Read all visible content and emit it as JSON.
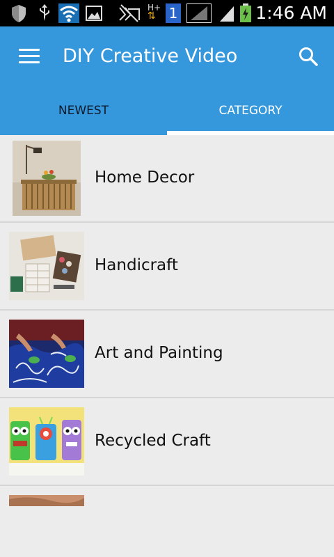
{
  "status_bar": {
    "time": "1:46 AM",
    "signal_badge": "1",
    "network_label": "H+"
  },
  "app_bar": {
    "title": "DIY Creative Video"
  },
  "tabs": [
    {
      "label": "NEWEST",
      "selected": false
    },
    {
      "label": "CATEGORY",
      "selected": true
    }
  ],
  "categories": [
    {
      "label": "Home Decor"
    },
    {
      "label": "Handicraft"
    },
    {
      "label": "Art and Painting"
    },
    {
      "label": "Recycled Craft"
    }
  ],
  "colors": {
    "accent": "#3597dc",
    "background": "#ececec"
  },
  "icons": {
    "menu": "hamburger-icon",
    "search": "search-icon"
  }
}
